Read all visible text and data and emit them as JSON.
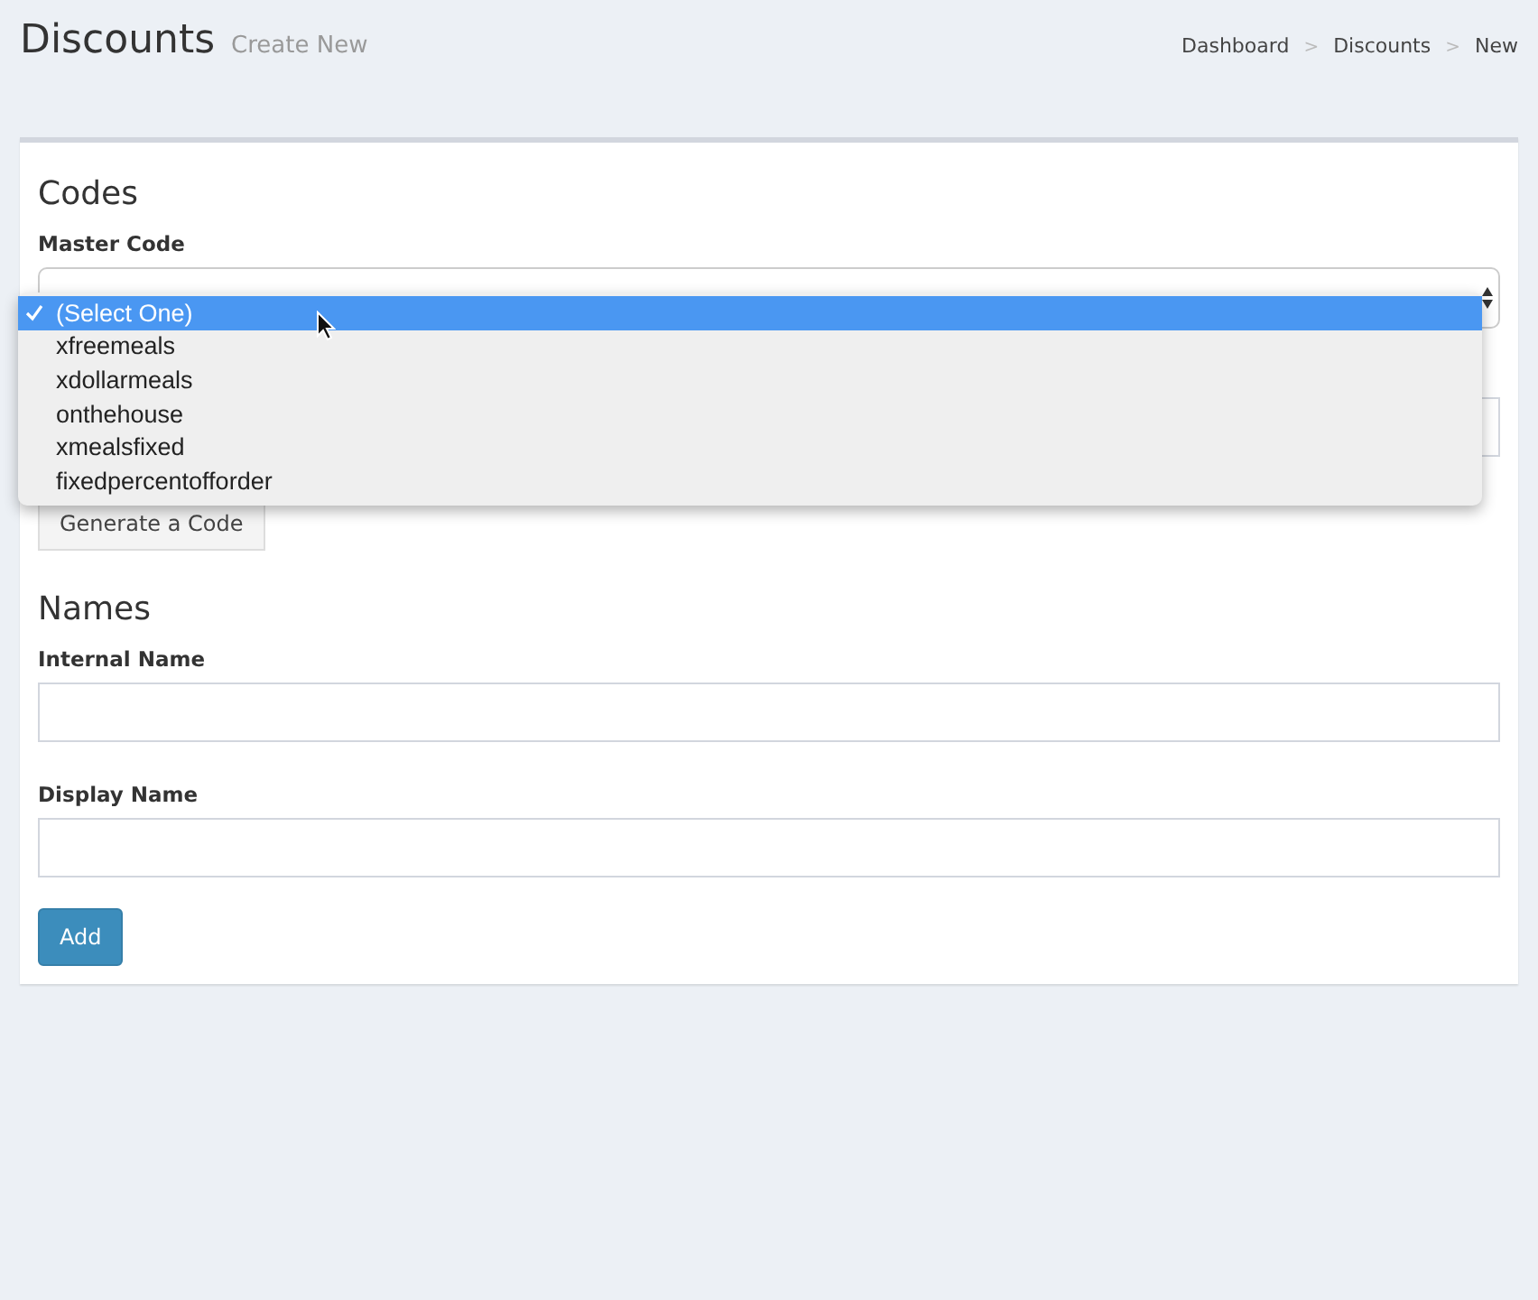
{
  "header": {
    "title": "Discounts",
    "subtitle": "Create New"
  },
  "breadcrumb": [
    {
      "label": "Dashboard"
    },
    {
      "separator": ">",
      "label": "Discounts"
    },
    {
      "separator": ">",
      "label": "New"
    }
  ],
  "codes_section": {
    "title": "Codes",
    "master_code": {
      "label": "Master Code",
      "options": [
        {
          "label": "(Select One)",
          "selected": true
        },
        {
          "label": "xfreemeals",
          "selected": false
        },
        {
          "label": "xdollarmeals",
          "selected": false
        },
        {
          "label": "onthehouse",
          "selected": false
        },
        {
          "label": "xmealsfixed",
          "selected": false
        },
        {
          "label": "fixedpercentofforder",
          "selected": false
        }
      ]
    },
    "generate_button": "Generate a Code"
  },
  "names_section": {
    "title": "Names",
    "fields": [
      {
        "label": "Internal Name"
      },
      {
        "label": "Display Name"
      }
    ]
  },
  "submit_button": "Add"
}
